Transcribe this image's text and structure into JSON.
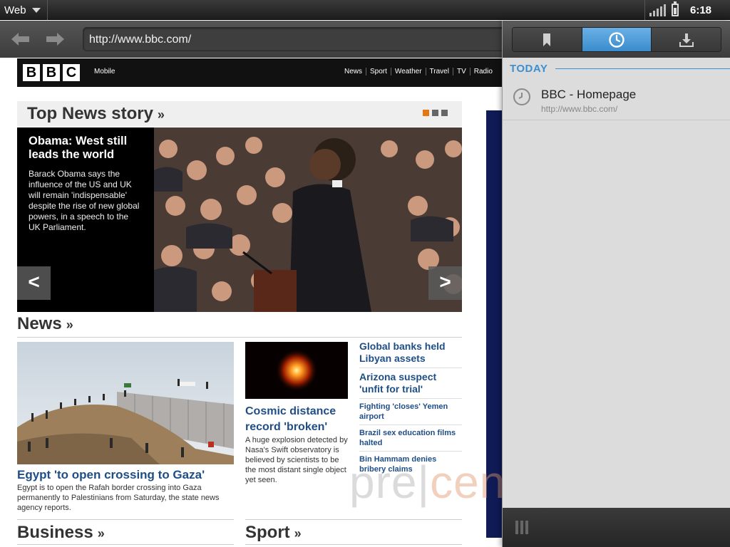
{
  "status_bar": {
    "app_name": "Web",
    "time": "6:18"
  },
  "toolbar": {
    "url": "http://www.bbc.com/"
  },
  "bbc": {
    "logo_letters": [
      "B",
      "B",
      "C"
    ],
    "mobile_label": "Mobile",
    "nav": [
      "News",
      "Sport",
      "Weather",
      "Travel",
      "TV",
      "Radio"
    ]
  },
  "top_story": {
    "section": "Top News story",
    "headline": "Obama: West still leads the world",
    "summary": "Barack Obama says the influence of the US and UK will remain 'indispensable' despite the rise of new global powers, in a speech to the UK Parliament.",
    "prev_label": "<",
    "next_label": ">"
  },
  "news": {
    "section": "News",
    "lead": {
      "title": "Egypt 'to open crossing to Gaza'",
      "summary": "Egypt is to open the Rafah border crossing into Gaza permanently to Palestinians from Saturday, the state news agency reports."
    },
    "second": {
      "title": "Cosmic distance record 'broken'",
      "summary": "A huge explosion detected by Nasa's Swift observatory is believed by scientists to be the most distant single object yet seen."
    },
    "headlines": [
      "Global banks held Libyan assets",
      "Arizona suspect 'unfit for trial'",
      "Fighting 'closes' Yemen airport",
      "Brazil sex education films halted",
      "Bin Hammam denies bribery claims"
    ]
  },
  "sections": {
    "business": "Business",
    "sport": "Sport"
  },
  "watermark": {
    "part1": "pre|",
    "part2": "central.net"
  },
  "drawer": {
    "tabs": [
      {
        "name": "bookmarks",
        "icon": "bookmark-icon"
      },
      {
        "name": "history",
        "icon": "clock-icon",
        "active": true
      },
      {
        "name": "downloads",
        "icon": "download-icon"
      }
    ],
    "group_label": "TODAY",
    "items": [
      {
        "title": "BBC - Homepage",
        "url": "http://www.bbc.com/"
      }
    ]
  },
  "colors": {
    "accent_blue": "#3c8fd1",
    "bbc_link": "#1f4e86",
    "orange_dot": "#e87514"
  }
}
